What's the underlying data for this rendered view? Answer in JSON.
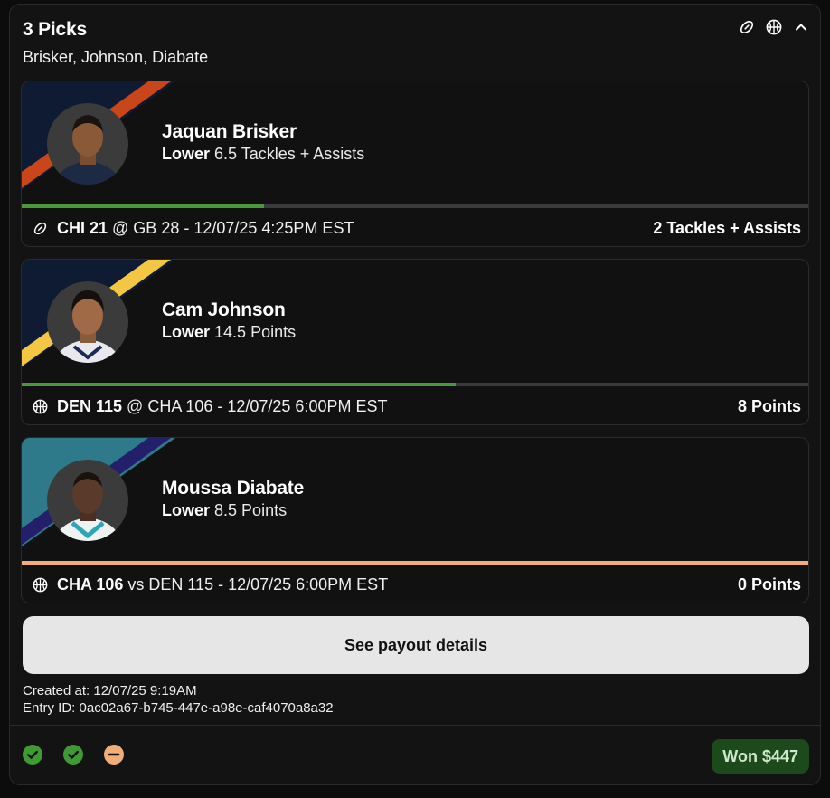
{
  "entry": {
    "title": "3 Picks",
    "subtitle": "Brisker, Johnson, Diabate",
    "header_icons": [
      "football-icon",
      "basketball-icon",
      "chevron-up-icon"
    ]
  },
  "picks": [
    {
      "name": "Jaquan Brisker",
      "direction": "Lower",
      "line": "6.5 Tackles + Assists",
      "sport_icon": "football-icon",
      "team_bold": "CHI 21",
      "game_rest": " @ GB 28 - 12/07/25 4:25PM EST",
      "result": "2 Tackles + Assists",
      "progress": 0.308,
      "progress_color": "#4a9a3c",
      "stripe_colors": [
        "#0e1b33",
        "#c8461a"
      ]
    },
    {
      "name": "Cam Johnson",
      "direction": "Lower",
      "line": "14.5 Points",
      "sport_icon": "basketball-icon",
      "team_bold": "DEN 115",
      "game_rest": " @ CHA 106 - 12/07/25 6:00PM EST",
      "result": "8 Points",
      "progress": 0.552,
      "progress_color": "#4a9a3c",
      "stripe_colors": [
        "#0e1b33",
        "#f3c744"
      ]
    },
    {
      "name": "Moussa Diabate",
      "direction": "Lower",
      "line": "8.5 Points",
      "sport_icon": "basketball-icon",
      "team_bold": "CHA 106",
      "game_rest": " vs DEN 115 - 12/07/25 6:00PM EST",
      "result": "0 Points",
      "progress": 1.0,
      "progress_color": "#f0ad78",
      "stripe_colors": [
        "#2e7a8a",
        "#231f6b"
      ]
    }
  ],
  "payout_button": "See payout details",
  "created_at": "Created at: 12/07/25 9:19AM",
  "entry_id": "Entry ID: 0ac02a67-b745-447e-a98e-caf4070a8a32",
  "status_icons": [
    {
      "icon": "check-circle-icon",
      "color": "#3f9a34"
    },
    {
      "icon": "check-circle-icon",
      "color": "#3f9a34"
    },
    {
      "icon": "minus-circle-icon",
      "color": "#f0ad78"
    }
  ],
  "won_badge": "Won $447"
}
